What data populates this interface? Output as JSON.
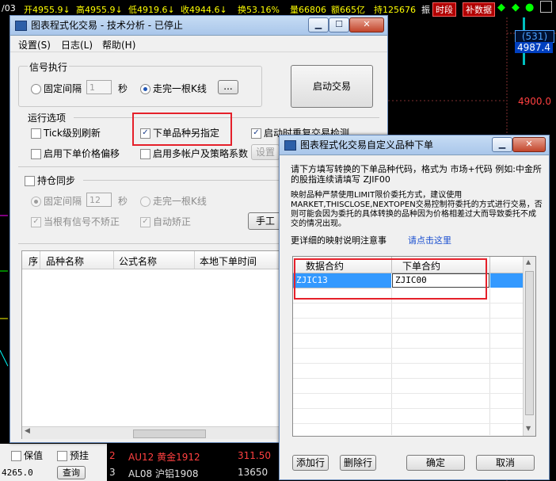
{
  "bg": {
    "topbar": {
      "date": "/03",
      "open": "开4955.9↓",
      "high": "高4955.9↓",
      "low": "低4919.6↓",
      "close": "收4944.6↓",
      "change": "换53.16%",
      "volume": "量66806",
      "amount": "额665亿",
      "hold": "持125676",
      "zhen": "振",
      "time_button": "时段",
      "supplement_button": "补数据"
    },
    "right_prices": {
      "count": "(531)",
      "price1": "4987.4",
      "price2": "4900.0"
    },
    "bottom": {
      "baozhi": "保值",
      "yushe": "预挂",
      "price": "4265.0",
      "chakan": "查询",
      "row2_no": "2",
      "row2_name": "AU12 黄金1912",
      "row2_price": "311.50",
      "row3_no": "3",
      "row3_name": "AL08 沪铝1908",
      "row3_price": "13650"
    }
  },
  "main_window": {
    "title": "图表程式化交易 - 技术分析 - 已停止",
    "menu": [
      "设置(S)",
      "日志(L)",
      "帮助(H)"
    ],
    "signal_group": {
      "title": "信号执行",
      "fixed_interval": "固定间隔",
      "interval_value": "1",
      "sec": "秒",
      "after_bar": "走完一根K线",
      "more": "..."
    },
    "start_button": "启动交易",
    "run_options": {
      "title": "运行选项",
      "tick_refresh": "Tick级别刷新",
      "order_instrument": "下单品种另指定",
      "startup_check": "启动时重复交易检测",
      "price_offset": "启用下单价格偏移",
      "multi_account": "启用多帐户及策略系数",
      "settings_btn": "设置"
    },
    "sync_group": {
      "title": "持仓同步",
      "fixed_interval": "固定间隔",
      "interval_value": "12",
      "sec": "秒",
      "after_bar": "走完一根K线",
      "no_correct": "当根有信号不矫正",
      "auto_correct": "自动矫正",
      "manual_btn": "手工"
    },
    "table_headers": [
      "序",
      "品种名称",
      "公式名称",
      "本地下单时间"
    ]
  },
  "dialog": {
    "title": "图表程式化交易自定义品种下单",
    "desc1": "请下方填写转换的下单品种代码，格式为 市场+代码 例如:中金所的股指连续请填写 ZJIF00",
    "desc2": "映射品种严禁使用LIMIT限价委托方式，建议使用MARKET,THISCLOSE,NEXTOPEN交易控制符委托的方式进行交易，否则可能会因为委托的具体转换的品种因为价格相差过大而导致委托不成交的情况出现。",
    "detail_text": "更详细的映射说明注意事",
    "detail_link": "请点击这里",
    "table": {
      "headers": [
        "数据合约",
        "下单合约"
      ],
      "rows": [
        [
          "ZJIC13",
          "ZJIC00"
        ]
      ]
    },
    "add_btn": "添加行",
    "del_btn": "删除行",
    "ok_btn": "确定",
    "cancel_btn": "取消"
  }
}
